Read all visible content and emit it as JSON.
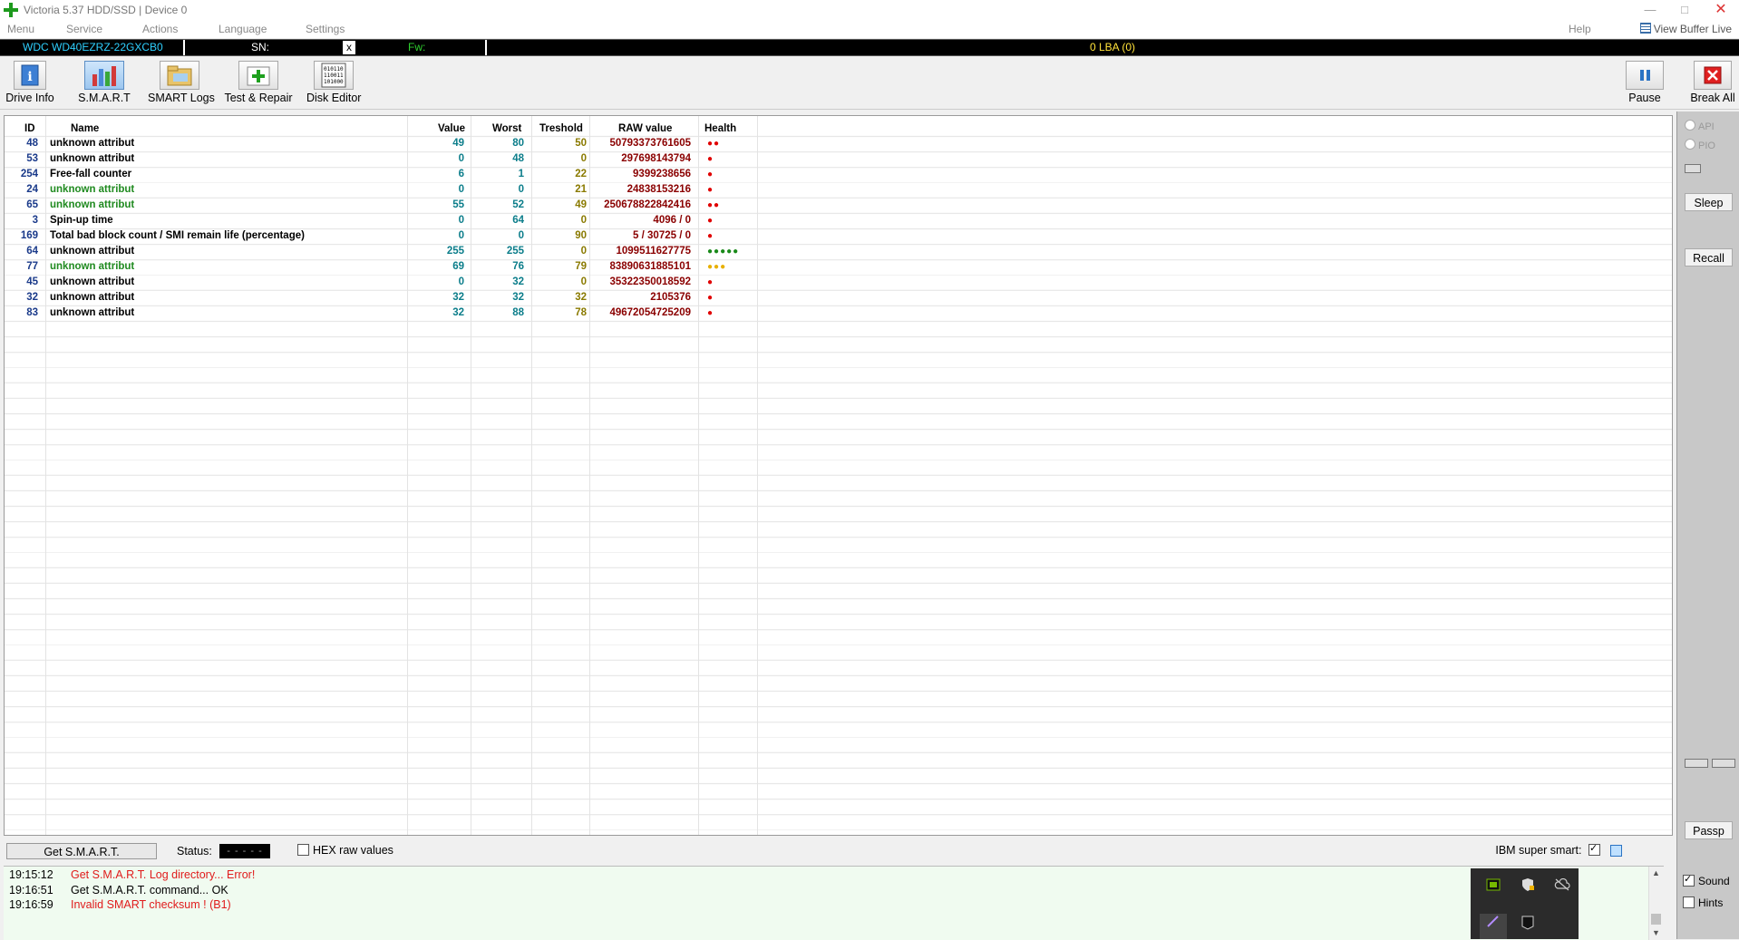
{
  "window": {
    "title": "Victoria 5.37 HDD/SSD | Device 0",
    "controls": {
      "minimize": "—",
      "maximize": "□",
      "close": "✕"
    }
  },
  "menu": {
    "items": [
      "Menu",
      "Service",
      "Actions",
      "Language",
      "Settings",
      "Help"
    ],
    "view_buffer_live": "View Buffer Live"
  },
  "infobar": {
    "model": "WDC WD40EZRZ-22GXCB0",
    "sn_label": "SN:",
    "sn_clear": "x",
    "fw_label": "Fw:",
    "lba": "0 LBA (0)"
  },
  "toolbar": {
    "drive_info": "Drive Info",
    "smart": "S.M.A.R.T",
    "smart_logs": "SMART Logs",
    "test_repair": "Test & Repair",
    "disk_editor": "Disk Editor",
    "pause": "Pause",
    "break_all": "Break All"
  },
  "table": {
    "headers": {
      "id": "ID",
      "name": "Name",
      "value": "Value",
      "worst": "Worst",
      "threshold": "Treshold",
      "raw": "RAW value",
      "health": "Health"
    },
    "rows": [
      {
        "id": "48",
        "name": "unknown attribut",
        "value": "49",
        "worst": "80",
        "threshold": "50",
        "raw": "50793373761605",
        "health": "●●",
        "health_color": "#e00000",
        "name_color": "black"
      },
      {
        "id": "53",
        "name": "unknown attribut",
        "value": "0",
        "worst": "48",
        "threshold": "0",
        "raw": "297698143794",
        "health": "●",
        "health_color": "#e00000",
        "name_color": "black"
      },
      {
        "id": "254",
        "name": "Free-fall counter",
        "value": "6",
        "worst": "1",
        "threshold": "22",
        "raw": "9399238656",
        "health": "●",
        "health_color": "#e00000",
        "name_color": "black"
      },
      {
        "id": "24",
        "name": "unknown attribut",
        "value": "0",
        "worst": "0",
        "threshold": "21",
        "raw": "24838153216",
        "health": "●",
        "health_color": "#e00000",
        "name_color": "green"
      },
      {
        "id": "65",
        "name": "unknown attribut",
        "value": "55",
        "worst": "52",
        "threshold": "49",
        "raw": "250678822842416",
        "health": "●●",
        "health_color": "#e00000",
        "name_color": "green"
      },
      {
        "id": "3",
        "name": "Spin-up time",
        "value": "0",
        "worst": "64",
        "threshold": "0",
        "raw": "4096 / 0",
        "health": "●",
        "health_color": "#e00000",
        "name_color": "black"
      },
      {
        "id": "169",
        "name": "Total bad block count / SMI remain life (percentage)",
        "value": "0",
        "worst": "0",
        "threshold": "90",
        "raw": "5 / 30725 / 0",
        "health": "●",
        "health_color": "#e00000",
        "name_color": "black"
      },
      {
        "id": "64",
        "name": "unknown attribut",
        "value": "255",
        "worst": "255",
        "threshold": "0",
        "raw": "1099511627775",
        "health": "●●●●●",
        "health_color": "#1a8a1a",
        "name_color": "black"
      },
      {
        "id": "77",
        "name": "unknown attribut",
        "value": "69",
        "worst": "76",
        "threshold": "79",
        "raw": "83890631885101",
        "health": "●●●",
        "health_color": "#e8b000",
        "name_color": "green"
      },
      {
        "id": "45",
        "name": "unknown attribut",
        "value": "0",
        "worst": "32",
        "threshold": "0",
        "raw": "35322350018592",
        "health": "●",
        "health_color": "#e00000",
        "name_color": "black"
      },
      {
        "id": "32",
        "name": "unknown attribut",
        "value": "32",
        "worst": "32",
        "threshold": "32",
        "raw": "2105376",
        "health": "●",
        "health_color": "#e00000",
        "name_color": "black"
      },
      {
        "id": "83",
        "name": "unknown attribut",
        "value": "32",
        "worst": "88",
        "threshold": "78",
        "raw": "49672054725209",
        "health": "●",
        "health_color": "#e00000",
        "name_color": "black"
      }
    ]
  },
  "side": {
    "api": "API",
    "pio": "PIO",
    "sleep": "Sleep",
    "recall": "Recall",
    "passp": "Passp",
    "sound": "Sound",
    "hints": "Hints",
    "sound_checked": true,
    "hints_checked": false
  },
  "status": {
    "get_smart": "Get S.M.A.R.T.",
    "status_label": "Status:",
    "status_value": "- - - - -",
    "hex_label": "HEX raw values",
    "ibm_label": "IBM super smart:"
  },
  "log": [
    {
      "time": "19:15:12",
      "message": "Get S.M.A.R.T. Log directory... Error!",
      "color": "red"
    },
    {
      "time": "19:16:51",
      "message": "Get S.M.A.R.T. command... OK",
      "color": "black"
    },
    {
      "time": "19:16:59",
      "message": "Invalid SMART checksum ! (B1)",
      "color": "red"
    }
  ],
  "tray_icons": [
    "nvidia-icon",
    "security-shield-icon",
    "cloud-offline-icon",
    "pen-icon",
    "epic-games-icon"
  ]
}
